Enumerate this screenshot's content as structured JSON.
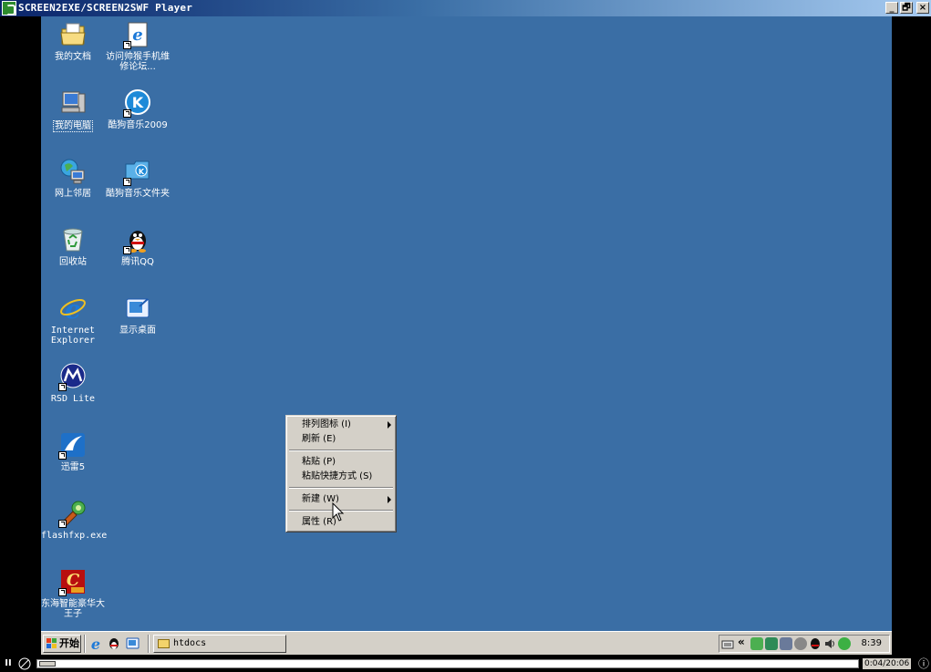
{
  "window": {
    "title": "SCREEN2EXE/SCREEN2SWF Player",
    "minimize_label": "_",
    "restore_label": "🗗",
    "close_label": "×"
  },
  "desktop": {
    "background_color": "#3a6ea5",
    "icons": [
      {
        "label": "我的文档",
        "icon": "my-documents-icon"
      },
      {
        "label": "访问帅猴手机维修论坛...",
        "icon": "ie-shortcut-icon"
      },
      {
        "label": "我的电脑",
        "icon": "my-computer-icon"
      },
      {
        "label": "酷狗音乐2009",
        "icon": "kugou-icon"
      },
      {
        "label": "网上邻居",
        "icon": "network-icon"
      },
      {
        "label": "酷狗音乐文件夹",
        "icon": "kugou-folder-icon"
      },
      {
        "label": "回收站",
        "icon": "recycle-bin-icon"
      },
      {
        "label": "腾讯QQ",
        "icon": "qq-penguin-icon"
      },
      {
        "label": "Internet Explorer",
        "icon": "ie-icon"
      },
      {
        "label": "显示桌面",
        "icon": "show-desktop-icon"
      },
      {
        "label": "RSD Lite",
        "icon": "motorola-icon"
      },
      {
        "label": "迅雷5",
        "icon": "thunder-icon"
      },
      {
        "label": "flashfxp.exe",
        "icon": "flashfxp-icon"
      },
      {
        "label": "东海智能豪华大王子",
        "icon": "donghai-icon"
      }
    ]
  },
  "context_menu": {
    "items": [
      {
        "label": "排列图标 (I)",
        "submenu": true
      },
      {
        "label": "刷新 (E)",
        "submenu": false
      },
      {
        "label": "粘贴 (P)",
        "submenu": false
      },
      {
        "label": "粘贴快捷方式 (S)",
        "submenu": false
      },
      {
        "label": "新建 (W)",
        "submenu": true
      },
      {
        "label": "属性 (R)",
        "submenu": false
      }
    ]
  },
  "taskbar": {
    "start_label": "开始",
    "quick_launch": [
      "ie-icon",
      "qq-icon",
      "show-desktop-icon"
    ],
    "tasks": [
      {
        "label": "htdocs",
        "icon": "folder-icon"
      }
    ],
    "tray_icons": [
      "keyboard-icon",
      "expand-chevron-icon",
      "network-icon",
      "app-icon",
      "app-icon",
      "shield-icon",
      "qq-icon",
      "volume-icon",
      "update-icon"
    ],
    "expand_label": "«",
    "clock": "8:39"
  },
  "player": {
    "pause_label": "II",
    "time_display": "0:04/20:06",
    "info_label": "ⓘ"
  }
}
